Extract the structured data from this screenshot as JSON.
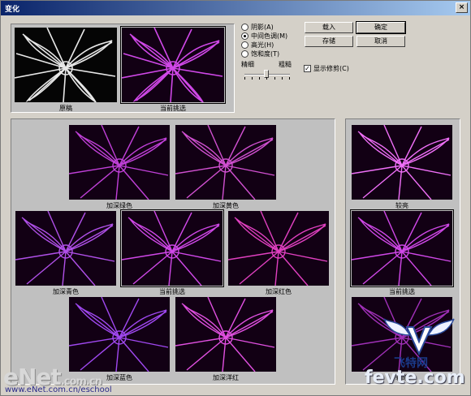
{
  "window": {
    "title": "变化",
    "close_glyph": "×"
  },
  "preview": {
    "original_label": "原稿",
    "current_label": "当前挑选"
  },
  "tone": {
    "options": [
      "阴影(A)",
      "中间色调(M)",
      "高光(H)",
      "饱和度(T)"
    ],
    "selected": "中间色调(M)",
    "fine_label": "精细",
    "coarse_label": "粗糙"
  },
  "buttons": {
    "load": "载入",
    "ok": "确定",
    "save": "存储",
    "cancel": "取消"
  },
  "show_clipping": {
    "label": "显示修剪(C)",
    "checked": true
  },
  "variations": {
    "items": [
      "加深绿色",
      "加深黄色",
      "加深青色",
      "当前挑选",
      "加深红色",
      "加深蓝色",
      "加深洋红"
    ]
  },
  "brightness": {
    "items": [
      "较亮",
      "当前挑选",
      "较暗"
    ]
  },
  "watermarks": {
    "enet": "eNet",
    "enet_com": ".com.cn",
    "url": "www.eNet.com.cn/eschool",
    "site": "fevte.com",
    "site_cn": "飞特网"
  },
  "colors": {
    "dialog_bg": "#d4d0c8",
    "titlebar_start": "#0a246a",
    "titlebar_end": "#a6caf0",
    "flower_magenta": "#d040e0"
  }
}
